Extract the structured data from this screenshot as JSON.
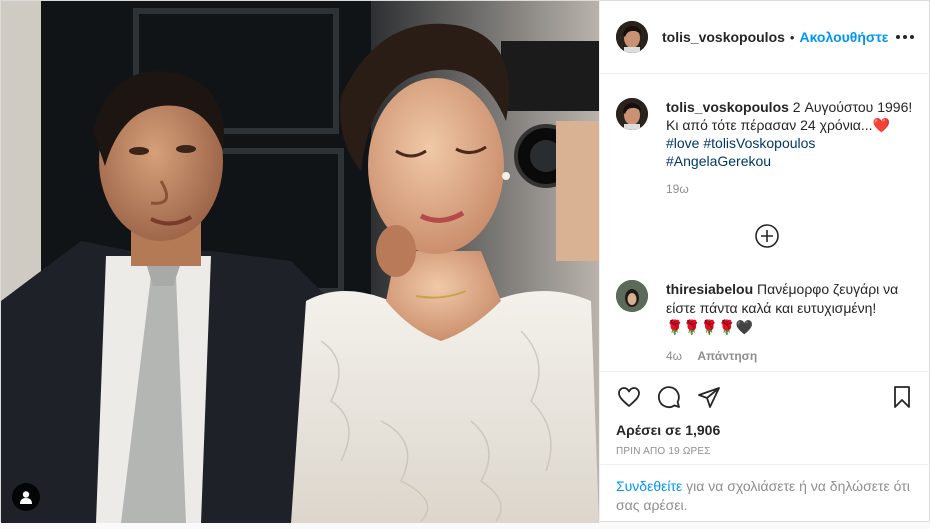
{
  "post": {
    "author": "tolis_voskopoulos",
    "follow_label": "Ακολουθήστε",
    "separator": "•",
    "caption": {
      "username": "tolis_voskopoulos",
      "text": " 2 Αυγούστου 1996! Κι από τότε πέρασαν 24 χρόνια...",
      "emoji": "❤️",
      "hashtags": [
        "#love",
        "#tolisVoskopoulos",
        "#AngelaGerekou"
      ],
      "time": "19ω"
    },
    "comment": {
      "username": "thiresiabelou",
      "text": " Πανέμορφο ζευγάρι να είστε πάντα καλά και ευτυχισμένη!",
      "emoji_line": "🌹🌹🌹🌹🖤",
      "time": "4ω",
      "reply_label": "Απάντηση"
    },
    "likes_label": "Αρέσει σε 1,906",
    "date_label": "ΠΡΙΝ ΑΠΟ 19 ΩΡΕΣ",
    "login_link": "Συνδεθείτε",
    "login_text": " για να σχολιάσετε ή να δηλώσετε ότι σας αρέσει."
  },
  "icons": {
    "more": "more-options-icon",
    "add_comments": "plus-circle-icon",
    "like": "heart-icon",
    "comment": "comment-bubble-icon",
    "share": "paper-plane-icon",
    "save": "bookmark-icon",
    "tag": "user-tag-icon"
  }
}
